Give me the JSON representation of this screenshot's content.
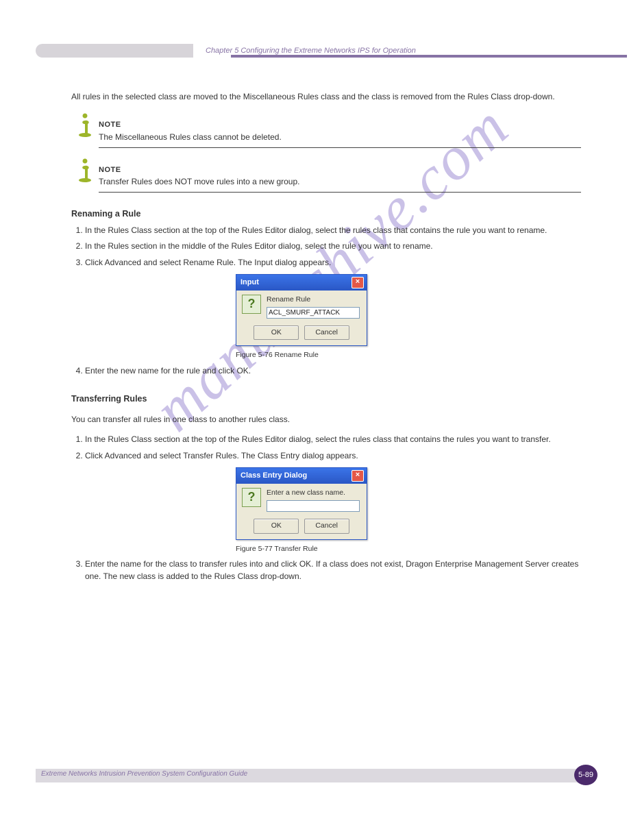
{
  "header": {
    "breadcrumb": "Chapter 5 Configuring the Extreme Networks IPS for Operation"
  },
  "content": {
    "intro_para": "All rules in the selected class are moved to the Miscellaneous Rules class and the class is removed from the Rules Class drop-down.",
    "note1": {
      "label": "NOTE",
      "text": "The Miscellaneous Rules class cannot be deleted."
    },
    "note2": {
      "label": "NOTE",
      "text": "Transfer Rules does NOT move rules into a new group."
    },
    "rename_head": "Renaming a Rule",
    "rename_steps": [
      "In the Rules Class section at the top of the Rules Editor dialog, select the rules class that contains the rule you want to rename.",
      "In the Rules section in the middle of the Rules Editor dialog, select the rule you want to rename.",
      "Click Advanced and select Rename Rule.  The Input dialog appears."
    ],
    "rename_step4": "Enter the new name for the rule and click OK.",
    "transfer_head": "Transferring Rules",
    "transfer_intro": "You can transfer all rules in one class to another rules class.",
    "transfer_steps": [
      "In the Rules Class section at the top of the Rules Editor dialog, select the rules class that contains the rules you want to transfer.",
      "Click Advanced and select Transfer Rules.  The Class Entry dialog appears."
    ],
    "transfer_step3": "Enter the name for the class to transfer rules into and click OK.  If a class does not exist, Dragon Enterprise Management Server creates one. The new class is added to the Rules Class drop-down."
  },
  "dialog1": {
    "title": "Input",
    "label": "Rename Rule",
    "value": "ACL_SMURF_ATTACK",
    "ok": "OK",
    "cancel": "Cancel",
    "caption": "Figure 5-76   Rename Rule"
  },
  "dialog2": {
    "title": "Class Entry Dialog",
    "label": "Enter a new class name.",
    "ok": "OK",
    "cancel": "Cancel",
    "caption": "Figure 5-77   Transfer Rule"
  },
  "footer": {
    "text": "Extreme Networks Intrusion Prevention System Configuration Guide",
    "page": "5-89"
  },
  "watermark": "manualshive.com"
}
